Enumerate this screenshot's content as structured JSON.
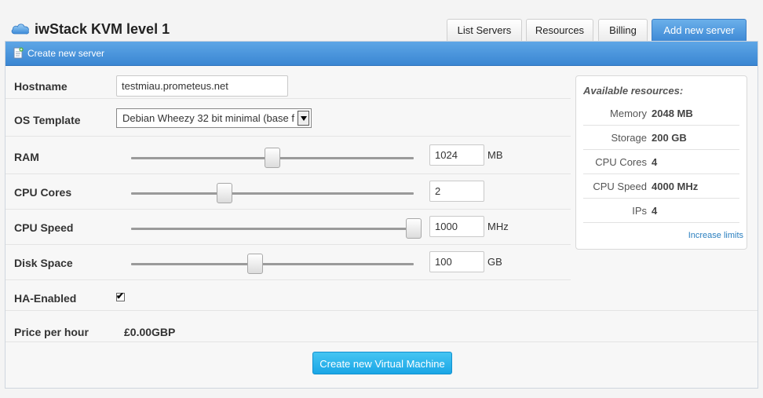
{
  "app": {
    "title": "iwStack KVM level 1"
  },
  "tabs": [
    {
      "label": "List Servers"
    },
    {
      "label": "Resources"
    },
    {
      "label": "Billing"
    },
    {
      "label": "Add new server",
      "active": true
    }
  ],
  "panel": {
    "title": "Create new server"
  },
  "form": {
    "hostname": {
      "label": "Hostname",
      "value": "testmiau.prometeus.net"
    },
    "os_template": {
      "label": "OS Template",
      "selected": "Debian Wheezy 32 bit minimal (base f"
    },
    "ram": {
      "label": "RAM",
      "value": "1024",
      "unit": "MB",
      "slider_fraction": 0.5
    },
    "cpu_cores": {
      "label": "CPU Cores",
      "value": "2",
      "slider_fraction": 0.33
    },
    "cpu_speed": {
      "label": "CPU Speed",
      "value": "1000",
      "unit": "MHz",
      "slider_fraction": 1.0
    },
    "disk_space": {
      "label": "Disk Space",
      "value": "100",
      "unit": "GB",
      "slider_fraction": 0.44
    },
    "ha_enabled": {
      "label": "HA-Enabled",
      "checked": true
    },
    "price": {
      "label": "Price per hour",
      "value": "£0.00GBP"
    },
    "submit_label": "Create new Virtual Machine"
  },
  "resources": {
    "title": "Available resources:",
    "items": [
      {
        "key": "Memory",
        "value": "2048 MB"
      },
      {
        "key": "Storage",
        "value": "200 GB"
      },
      {
        "key": "CPU Cores",
        "value": "4"
      },
      {
        "key": "CPU Speed",
        "value": "4000 MHz"
      },
      {
        "key": "IPs",
        "value": "4"
      }
    ],
    "link": "Increase limits"
  },
  "colors": {
    "accent": "#3f8ad6",
    "button": "#1aa6e6",
    "link": "#2a7fbf"
  },
  "icons": {
    "logo": "cloud-icon",
    "panel": "document-add-icon",
    "dropdown": "chevron-down-icon",
    "check": "checkmark-icon"
  }
}
